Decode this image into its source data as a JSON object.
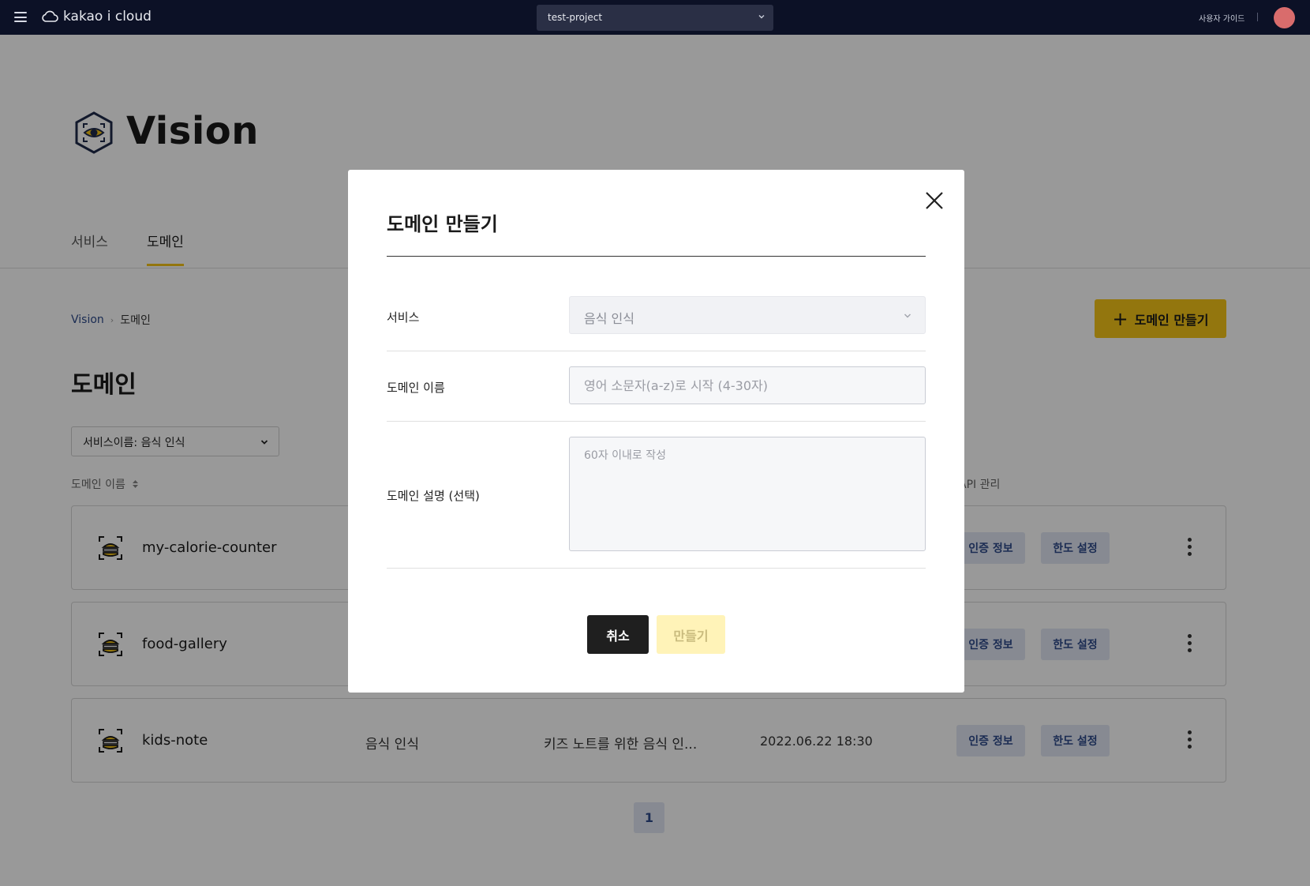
{
  "topbar": {
    "logo_text": "kakao i cloud",
    "project": "test-project",
    "guide_label": "사용자 가이드"
  },
  "page": {
    "title": "Vision",
    "tabs": [
      {
        "label": "서비스",
        "active": false
      },
      {
        "label": "도메인",
        "active": true
      }
    ],
    "breadcrumb": {
      "root": "Vision",
      "current": "도메인"
    },
    "create_button": "도메인 만들기",
    "heading": "도메인",
    "filter": "서비스이름: 음식 인식",
    "columns": {
      "name": "도메인 이름",
      "api": "API 관리"
    },
    "domains": [
      {
        "name": "my-calorie-counter",
        "service": "",
        "description": "",
        "date": "",
        "auth_label": "인증 정보",
        "limit_label": "한도 설정"
      },
      {
        "name": "food-gallery",
        "service": "",
        "description": "",
        "date": "",
        "auth_label": "인증 정보",
        "limit_label": "한도 설정"
      },
      {
        "name": "kids-note",
        "service": "음식 인식",
        "description": "키즈 노트를 위한 음식 인...",
        "date": "2022.06.22 18:30",
        "auth_label": "인증 정보",
        "limit_label": "한도 설정"
      }
    ],
    "pagination": {
      "current": "1"
    }
  },
  "modal": {
    "title": "도메인 만들기",
    "service_label": "서비스",
    "service_value": "음식 인식",
    "name_label": "도메인 이름",
    "name_placeholder": "영어 소문자(a-z)로 시작 (4-30자)",
    "desc_label": "도메인 설명 (선택)",
    "desc_placeholder": "60자 이내로 작성",
    "cancel_label": "취소",
    "create_label": "만들기"
  },
  "colors": {
    "nav_bg": "#0c1126",
    "accent_yellow": "#f5c518",
    "pill_bg": "#e2e7f3",
    "pill_text": "#2d4a8a"
  }
}
